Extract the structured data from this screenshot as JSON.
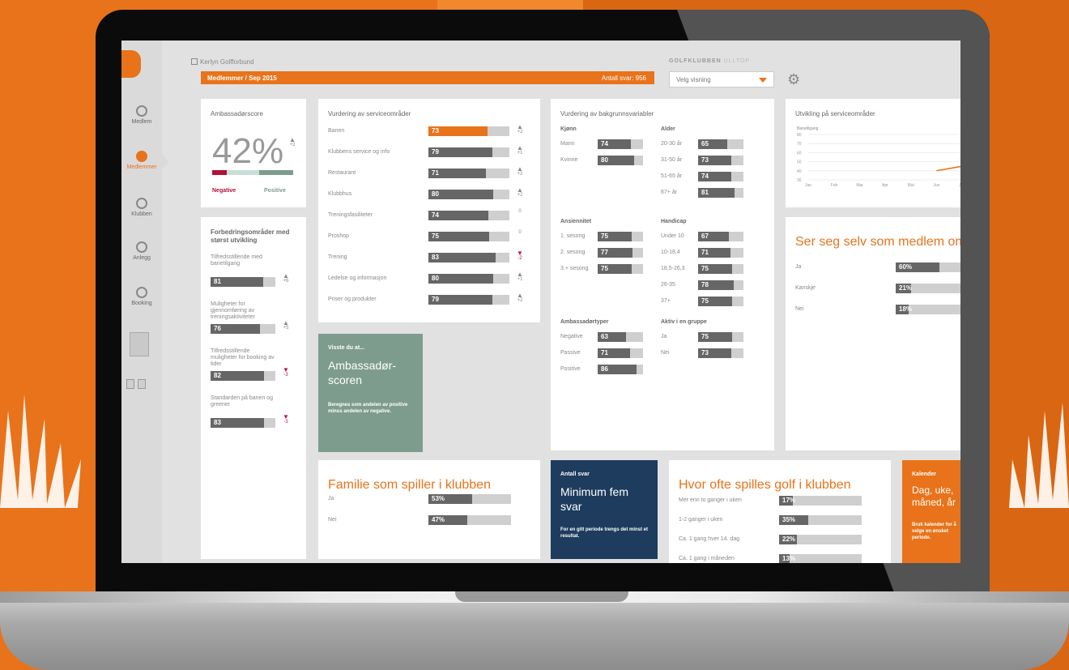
{
  "header": {
    "breadcrumb": "Kerlyn Golfforbund",
    "banner_title": "Medlemmer / Sep 2015",
    "banner_right": "Antall svar: 956",
    "club_label": "GOLFKLUBBEN",
    "club_extra": "ULLTOP",
    "select_value": "Velg visning"
  },
  "sidebar": {
    "items": [
      {
        "label": "Medlem",
        "icon": "person-icon"
      },
      {
        "label": "Medlemmer",
        "icon": "group-icon"
      },
      {
        "label": "Klubben",
        "icon": "plus-icon"
      },
      {
        "label": "Anlegg",
        "icon": "plus-icon"
      },
      {
        "label": "Booking",
        "icon": "circle-icon"
      }
    ]
  },
  "ambassador": {
    "title": "Ambassadørscore",
    "value": "42%",
    "trend": "+2",
    "negative_label": "Negative",
    "positive_label": "Positive",
    "negative_share": 0.18,
    "neutral_share": 0.4,
    "positive_share": 0.42
  },
  "drivers": {
    "title": "Forbedringsområder med størst utvikling",
    "items": [
      {
        "label": "Tilfredsstillende med banetilgang",
        "value": 81,
        "trend": "+6",
        "dir": "up"
      },
      {
        "label": "Muligheter for gjennomføring av treningsaktiviteter",
        "value": 76,
        "trend": "+5",
        "dir": "up"
      },
      {
        "label": "Tilfredsstillende muligheter for booking av tider",
        "value": 82,
        "trend": "-3",
        "dir": "down"
      },
      {
        "label": "Standarden på banen og greener",
        "value": 83,
        "trend": "-3",
        "dir": "down"
      }
    ]
  },
  "service": {
    "title": "Vurdering av serviceområder",
    "items": [
      {
        "label": "Banen",
        "value": 73,
        "trend": "+2",
        "dir": "up",
        "highlight": true
      },
      {
        "label": "Klubbens service og info",
        "value": 79,
        "trend": "+1",
        "dir": "up"
      },
      {
        "label": "Restaurant",
        "value": 71,
        "trend": "+2",
        "dir": "up"
      },
      {
        "label": "Klubbhus",
        "value": 80,
        "trend": "+2",
        "dir": "up"
      },
      {
        "label": "Treningsfasiliteter",
        "value": 74,
        "trend": "0",
        "dir": "flat"
      },
      {
        "label": "Proshop",
        "value": 75,
        "trend": "0",
        "dir": "flat"
      },
      {
        "label": "Trening",
        "value": 83,
        "trend": "-2",
        "dir": "down"
      },
      {
        "label": "Ledelse og informasjon",
        "value": 80,
        "trend": "+1",
        "dir": "up"
      },
      {
        "label": "Priser og produkter",
        "value": 79,
        "trend": "+2",
        "dir": "up"
      }
    ]
  },
  "segments": {
    "title": "Vurdering av bakgrunnsvariabler",
    "groups": [
      {
        "title": "Kjønn",
        "items": [
          {
            "label": "Mann",
            "value": 74
          },
          {
            "label": "Kvinne",
            "value": 80
          }
        ]
      },
      {
        "title": "Alder",
        "items": [
          {
            "label": "20-30 år",
            "value": 65
          },
          {
            "label": "31-50 år",
            "value": 73
          },
          {
            "label": "51-65 år",
            "value": 74
          },
          {
            "label": "67+ år",
            "value": 81
          }
        ]
      },
      {
        "title": "Ansiennitet",
        "items": [
          {
            "label": "1. sesong",
            "value": 75
          },
          {
            "label": "2. sesong",
            "value": 77
          },
          {
            "label": "3.+ sesong",
            "value": 75
          }
        ]
      },
      {
        "title": "Handicap",
        "items": [
          {
            "label": "Under 10",
            "value": 67
          },
          {
            "label": "10-18,4",
            "value": 71
          },
          {
            "label": "18,5-26,3",
            "value": 75
          },
          {
            "label": "26-35",
            "value": 78
          },
          {
            "label": "37+",
            "value": 75
          }
        ]
      },
      {
        "title": "Ambassadørtyper",
        "items": [
          {
            "label": "Negative",
            "value": 63
          },
          {
            "label": "Passive",
            "value": 71
          },
          {
            "label": "Positive",
            "value": 86
          }
        ]
      },
      {
        "title": "Aktiv i en gruppe",
        "items": [
          {
            "label": "Ja",
            "value": 75
          },
          {
            "label": "Nei",
            "value": 73
          }
        ]
      }
    ]
  },
  "trend_chart": {
    "title": "Utvikling på serviceområder",
    "axis_title": "Banetilgang",
    "y_ticks": [
      "80",
      "70",
      "60",
      "50",
      "40",
      "30"
    ],
    "x_ticks": [
      "Jan",
      "Feb",
      "Mar",
      "Apr",
      "Mai",
      "Jun",
      "Jul"
    ]
  },
  "chart_data": {
    "type": "line",
    "x": [
      "Jan",
      "Feb",
      "Mar",
      "Apr",
      "Mai",
      "Jun",
      "Jul"
    ],
    "series": [
      {
        "values": [
          null,
          null,
          null,
          null,
          null,
          40,
          45
        ]
      }
    ],
    "ylim": [
      30,
      80
    ]
  },
  "self_member": {
    "title": "Ser seg selv som medlem om",
    "items": [
      {
        "label": "Ja",
        "value": "60%",
        "pct": 60
      },
      {
        "label": "Kanskje",
        "value": "21%",
        "pct": 21
      },
      {
        "label": "Nei",
        "value": "18%",
        "pct": 18
      }
    ]
  },
  "did_you_know": {
    "heading": "Visste du at...",
    "big": "Ambassadør-scoren",
    "text": "Beregnes som andelen av positive minus andelen av negative."
  },
  "family": {
    "title": "Familie som spiller i klubben",
    "items": [
      {
        "label": "Ja",
        "value": "53%",
        "pct": 53
      },
      {
        "label": "Nei",
        "value": "47%",
        "pct": 47
      }
    ]
  },
  "answers": {
    "heading": "Antall svar",
    "big": "Minimum fem svar",
    "text": "For en gitt periode trengs det minst et resultat."
  },
  "frequency": {
    "title": "Hvor ofte spilles golf i klubben",
    "items": [
      {
        "label": "Mer enn to ganger i uken",
        "value": "17%",
        "pct": 17
      },
      {
        "label": "1-2 ganger i uken",
        "value": "35%",
        "pct": 35
      },
      {
        "label": "Ca. 1 gang hver 14. dag",
        "value": "22%",
        "pct": 22
      },
      {
        "label": "Ca. 1 gang i måneden",
        "value": "13%",
        "pct": 13
      }
    ]
  },
  "calendar": {
    "heading": "Kalender",
    "big": "Dag, uke, måned, år",
    "text": "Bruk kalender for å velge en ønsket periode."
  }
}
